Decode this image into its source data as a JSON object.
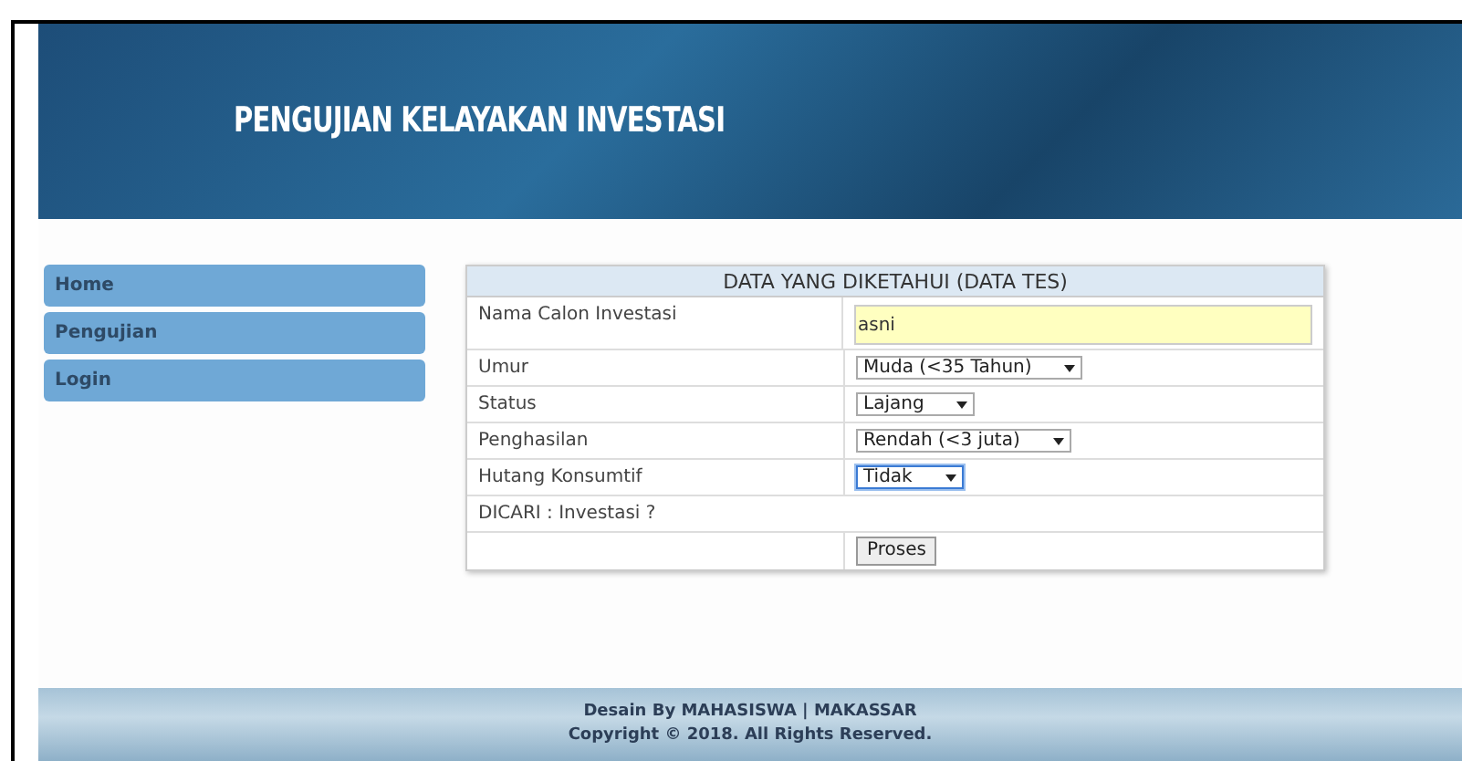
{
  "header": {
    "title": "PENGUJIAN KELAYAKAN INVESTASI"
  },
  "sidebar": {
    "items": [
      {
        "label": "Home"
      },
      {
        "label": "Pengujian"
      },
      {
        "label": "Login"
      }
    ]
  },
  "form": {
    "title": "DATA YANG DIKETAHUI (DATA TES)",
    "rows": [
      {
        "kind": "text",
        "label": "Nama Calon Investasi",
        "value": "asni"
      },
      {
        "kind": "select",
        "label": "Umur",
        "value": "Muda (<35 Tahun)"
      },
      {
        "kind": "select",
        "label": "Status",
        "value": "Lajang"
      },
      {
        "kind": "select",
        "label": "Penghasilan",
        "value": "Rendah (<3 juta)"
      },
      {
        "kind": "select",
        "label": "Hutang Konsumtif",
        "value": "Tidak",
        "focused": true
      },
      {
        "kind": "note",
        "label": "DICARI : Investasi ?"
      },
      {
        "kind": "button",
        "value": "Proses"
      }
    ]
  },
  "footer": {
    "lines": [
      "Desain By MAHASISWA | MAKASSAR",
      "Copyright © 2018. All Rights Reserved."
    ]
  }
}
